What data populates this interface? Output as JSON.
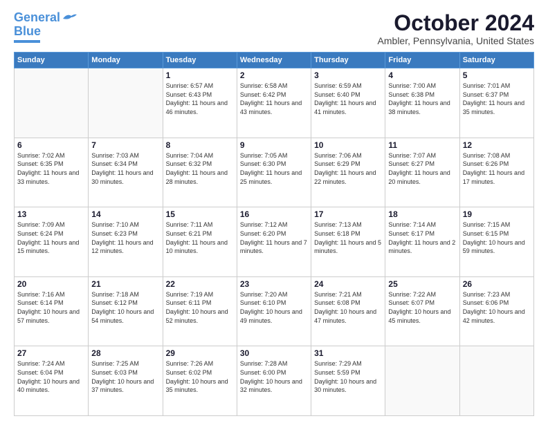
{
  "logo": {
    "line1": "General",
    "line2": "Blue"
  },
  "header": {
    "month": "October 2024",
    "location": "Ambler, Pennsylvania, United States"
  },
  "weekdays": [
    "Sunday",
    "Monday",
    "Tuesday",
    "Wednesday",
    "Thursday",
    "Friday",
    "Saturday"
  ],
  "weeks": [
    [
      {
        "day": "",
        "info": ""
      },
      {
        "day": "",
        "info": ""
      },
      {
        "day": "1",
        "info": "Sunrise: 6:57 AM\nSunset: 6:43 PM\nDaylight: 11 hours and 46 minutes."
      },
      {
        "day": "2",
        "info": "Sunrise: 6:58 AM\nSunset: 6:42 PM\nDaylight: 11 hours and 43 minutes."
      },
      {
        "day": "3",
        "info": "Sunrise: 6:59 AM\nSunset: 6:40 PM\nDaylight: 11 hours and 41 minutes."
      },
      {
        "day": "4",
        "info": "Sunrise: 7:00 AM\nSunset: 6:38 PM\nDaylight: 11 hours and 38 minutes."
      },
      {
        "day": "5",
        "info": "Sunrise: 7:01 AM\nSunset: 6:37 PM\nDaylight: 11 hours and 35 minutes."
      }
    ],
    [
      {
        "day": "6",
        "info": "Sunrise: 7:02 AM\nSunset: 6:35 PM\nDaylight: 11 hours and 33 minutes."
      },
      {
        "day": "7",
        "info": "Sunrise: 7:03 AM\nSunset: 6:34 PM\nDaylight: 11 hours and 30 minutes."
      },
      {
        "day": "8",
        "info": "Sunrise: 7:04 AM\nSunset: 6:32 PM\nDaylight: 11 hours and 28 minutes."
      },
      {
        "day": "9",
        "info": "Sunrise: 7:05 AM\nSunset: 6:30 PM\nDaylight: 11 hours and 25 minutes."
      },
      {
        "day": "10",
        "info": "Sunrise: 7:06 AM\nSunset: 6:29 PM\nDaylight: 11 hours and 22 minutes."
      },
      {
        "day": "11",
        "info": "Sunrise: 7:07 AM\nSunset: 6:27 PM\nDaylight: 11 hours and 20 minutes."
      },
      {
        "day": "12",
        "info": "Sunrise: 7:08 AM\nSunset: 6:26 PM\nDaylight: 11 hours and 17 minutes."
      }
    ],
    [
      {
        "day": "13",
        "info": "Sunrise: 7:09 AM\nSunset: 6:24 PM\nDaylight: 11 hours and 15 minutes."
      },
      {
        "day": "14",
        "info": "Sunrise: 7:10 AM\nSunset: 6:23 PM\nDaylight: 11 hours and 12 minutes."
      },
      {
        "day": "15",
        "info": "Sunrise: 7:11 AM\nSunset: 6:21 PM\nDaylight: 11 hours and 10 minutes."
      },
      {
        "day": "16",
        "info": "Sunrise: 7:12 AM\nSunset: 6:20 PM\nDaylight: 11 hours and 7 minutes."
      },
      {
        "day": "17",
        "info": "Sunrise: 7:13 AM\nSunset: 6:18 PM\nDaylight: 11 hours and 5 minutes."
      },
      {
        "day": "18",
        "info": "Sunrise: 7:14 AM\nSunset: 6:17 PM\nDaylight: 11 hours and 2 minutes."
      },
      {
        "day": "19",
        "info": "Sunrise: 7:15 AM\nSunset: 6:15 PM\nDaylight: 10 hours and 59 minutes."
      }
    ],
    [
      {
        "day": "20",
        "info": "Sunrise: 7:16 AM\nSunset: 6:14 PM\nDaylight: 10 hours and 57 minutes."
      },
      {
        "day": "21",
        "info": "Sunrise: 7:18 AM\nSunset: 6:12 PM\nDaylight: 10 hours and 54 minutes."
      },
      {
        "day": "22",
        "info": "Sunrise: 7:19 AM\nSunset: 6:11 PM\nDaylight: 10 hours and 52 minutes."
      },
      {
        "day": "23",
        "info": "Sunrise: 7:20 AM\nSunset: 6:10 PM\nDaylight: 10 hours and 49 minutes."
      },
      {
        "day": "24",
        "info": "Sunrise: 7:21 AM\nSunset: 6:08 PM\nDaylight: 10 hours and 47 minutes."
      },
      {
        "day": "25",
        "info": "Sunrise: 7:22 AM\nSunset: 6:07 PM\nDaylight: 10 hours and 45 minutes."
      },
      {
        "day": "26",
        "info": "Sunrise: 7:23 AM\nSunset: 6:06 PM\nDaylight: 10 hours and 42 minutes."
      }
    ],
    [
      {
        "day": "27",
        "info": "Sunrise: 7:24 AM\nSunset: 6:04 PM\nDaylight: 10 hours and 40 minutes."
      },
      {
        "day": "28",
        "info": "Sunrise: 7:25 AM\nSunset: 6:03 PM\nDaylight: 10 hours and 37 minutes."
      },
      {
        "day": "29",
        "info": "Sunrise: 7:26 AM\nSunset: 6:02 PM\nDaylight: 10 hours and 35 minutes."
      },
      {
        "day": "30",
        "info": "Sunrise: 7:28 AM\nSunset: 6:00 PM\nDaylight: 10 hours and 32 minutes."
      },
      {
        "day": "31",
        "info": "Sunrise: 7:29 AM\nSunset: 5:59 PM\nDaylight: 10 hours and 30 minutes."
      },
      {
        "day": "",
        "info": ""
      },
      {
        "day": "",
        "info": ""
      }
    ]
  ]
}
